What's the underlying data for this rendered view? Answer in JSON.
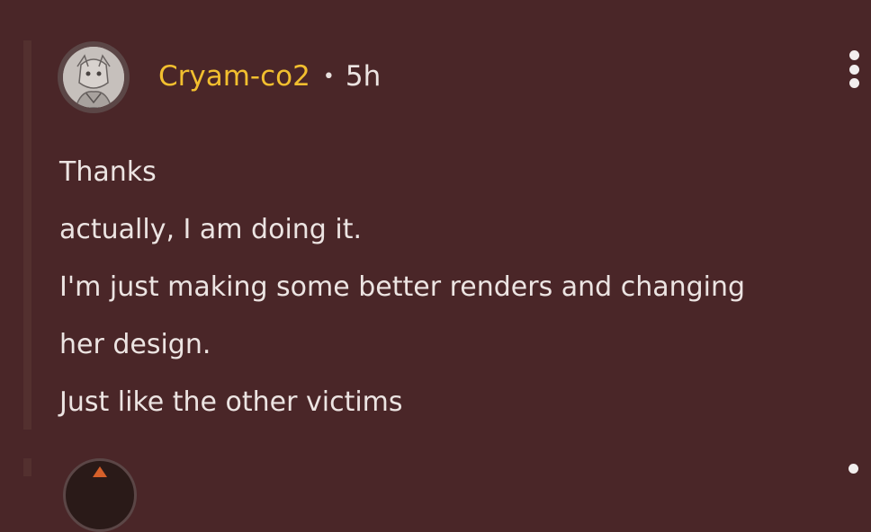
{
  "comment": {
    "username": "Cryam-co2",
    "separator": "•",
    "time": "5h",
    "lines": [
      "Thanks",
      "actually, I am doing it.",
      "I'm just making some better renders and changing",
      "her design.",
      "Just like the other victims"
    ]
  },
  "icons": {
    "menu": "more-vertical-icon",
    "avatar": "user-avatar"
  },
  "colors": {
    "background": "#4a2628",
    "username": "#f2bf2f",
    "text": "#ece4e2"
  }
}
